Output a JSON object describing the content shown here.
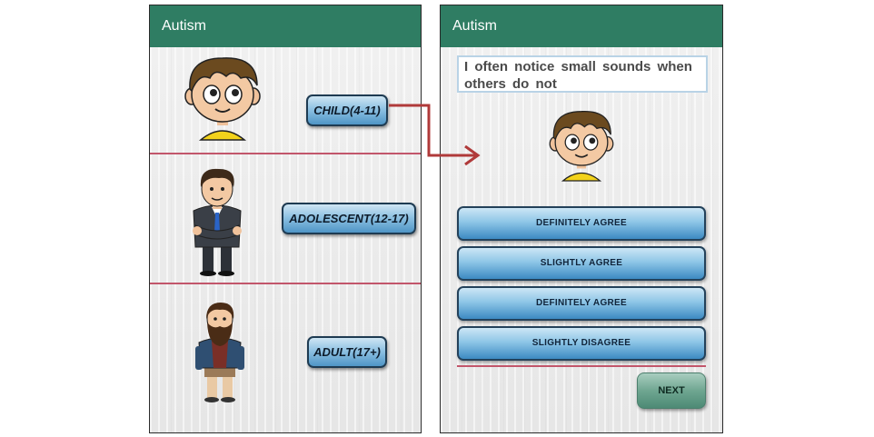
{
  "left_screen": {
    "app_title": "Autism",
    "sections": [
      {
        "label": "CHILD(4-11)",
        "avatar": "child-avatar"
      },
      {
        "label": "ADOLESCENT(12-17)",
        "avatar": "adolescent-avatar"
      },
      {
        "label": "ADULT(17+)",
        "avatar": "adult-avatar"
      }
    ]
  },
  "right_screen": {
    "app_title": "Autism",
    "question": "I often notice small sounds when others do not",
    "answers": [
      "DEFINITELY AGREE",
      "SLIGHTLY AGREE",
      "DEFINITELY AGREE",
      "SLIGHTLY DISAGREE"
    ],
    "next_label": "NEXT"
  },
  "colors": {
    "appbar": "#2f7d63",
    "divider": "#c2566b",
    "connector_arrow": "#b03a3a",
    "button_blue": "#4f95c6"
  }
}
